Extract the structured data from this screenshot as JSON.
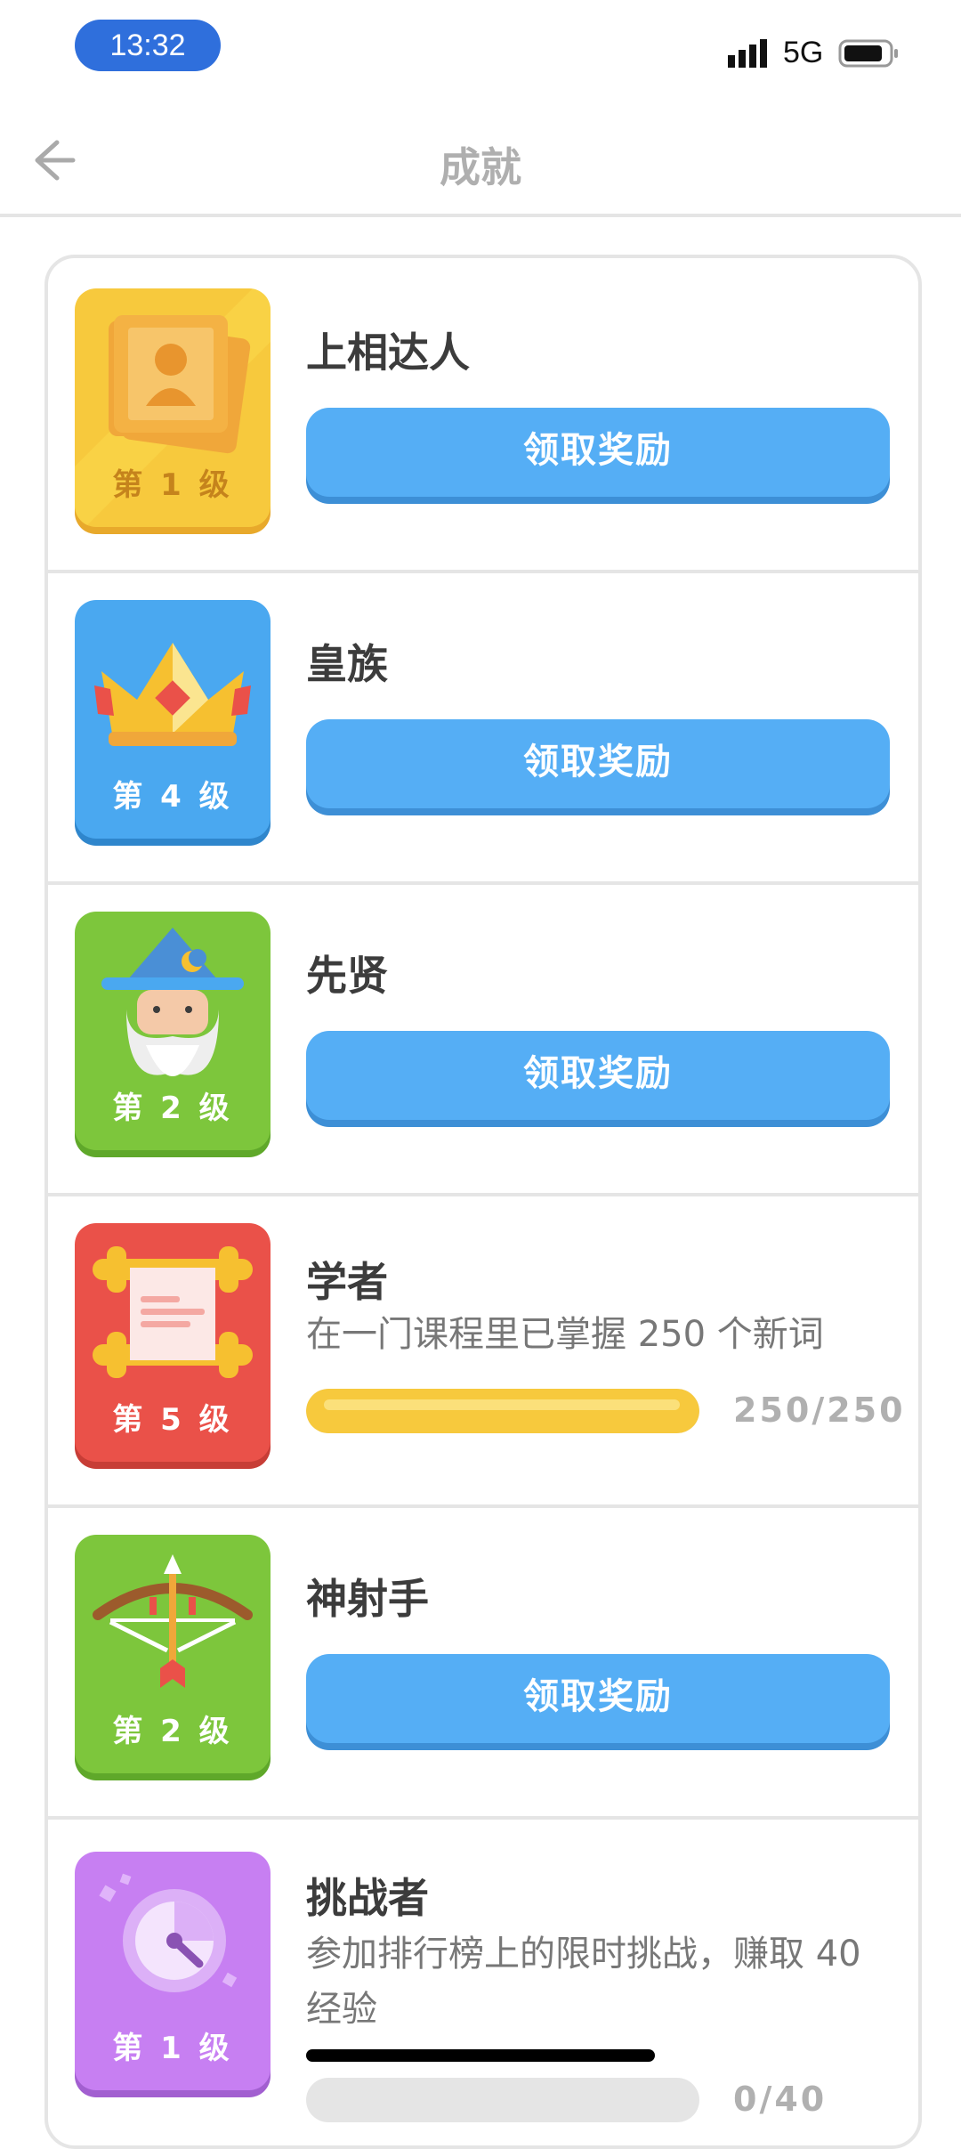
{
  "status_bar": {
    "time": "13:32",
    "network": "5G"
  },
  "header": {
    "title": "成就"
  },
  "achievements": [
    {
      "title": "上相达人",
      "level": "第 1 级",
      "action": "领取奖励",
      "badge_icon": "portrait-icon",
      "badge_color": "#f7c93d"
    },
    {
      "title": "皇族",
      "level": "第 4 级",
      "action": "领取奖励",
      "badge_icon": "crown-icon",
      "badge_color": "#4aa8f0"
    },
    {
      "title": "先贤",
      "level": "第 2 级",
      "action": "领取奖励",
      "badge_icon": "wizard-icon",
      "badge_color": "#7dc63c"
    },
    {
      "title": "学者",
      "level": "第 5 级",
      "description": "在一门课程里已掌握 250 个新词",
      "progress_text": "250/250",
      "progress": 1.0,
      "badge_icon": "scroll-icon",
      "badge_color": "#ea5149"
    },
    {
      "title": "神射手",
      "level": "第 2 级",
      "action": "领取奖励",
      "badge_icon": "bow-arrow-icon",
      "badge_color": "#7dc63c"
    },
    {
      "title": "挑战者",
      "level": "第 1 级",
      "description": "参加排行榜上的限时挑战，赚取 40 经验",
      "progress_text": "0/40",
      "progress": 0.0,
      "badge_icon": "stopwatch-icon",
      "badge_color": "#c77ff2"
    }
  ]
}
